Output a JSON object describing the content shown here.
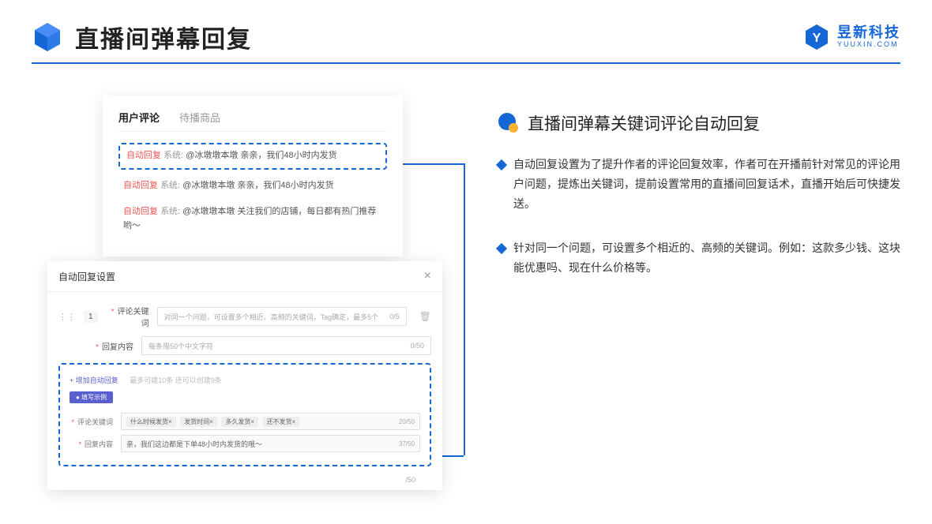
{
  "header": {
    "title": "直播间弹幕回复",
    "brand_cn": "昱新科技",
    "brand_en": "YUUXIN.COM"
  },
  "comment_panel": {
    "tabs": [
      "用户评论",
      "待播商品"
    ],
    "active_tab": 0,
    "items": [
      {
        "tag": "自动回复",
        "system": "系统:",
        "text": "@冰墩墩本墩 亲亲，我们48小时内发货",
        "highlight": true
      },
      {
        "tag": "自动回复",
        "system": "系统:",
        "text": "@冰墩墩本墩 亲亲，我们48小时内发货",
        "highlight": false
      },
      {
        "tag": "自动回复",
        "system": "系统:",
        "text": "@冰墩墩本墩 关注我们的店铺，每日都有热门推荐哟～",
        "highlight": false
      }
    ]
  },
  "settings_panel": {
    "title": "自动回复设置",
    "index": "1",
    "form": {
      "keyword_label": "评论关键词",
      "keyword_placeholder": "对同一个问题，可设置多个相近、高频的关键词，Tag确定，最多5个",
      "keyword_counter": "0/5",
      "content_label": "回复内容",
      "content_placeholder": "每条限50个中文字符",
      "content_counter": "0/50"
    },
    "add_link": "+ 增加自动回复",
    "add_hint": "最多可建10条 还可以创建9条",
    "example_tag": "● 填写示例",
    "example": {
      "keyword_label": "评论关键词",
      "keyword_tags": [
        "什么时候发货×",
        "发货时间×",
        "多久发货×",
        "还不发货×"
      ],
      "keyword_counter": "20/50",
      "content_label": "回复内容",
      "content_text": "亲，我们这边都是下单48小时内发货的哦～",
      "content_counter": "37/50"
    },
    "trailing_counter": "/50"
  },
  "right": {
    "section_title": "直播间弹幕关键词评论自动回复",
    "bullets": [
      "自动回复设置为了提升作者的评论回复效率，作者可在开播前针对常见的评论用户问题，提炼出关键词，提前设置常用的直播间回复话术，直播开始后可快捷发送。",
      "针对同一个问题，可设置多个相近的、高频的关键词。例如：这款多少钱、这块能优惠吗、现在什么价格等。"
    ]
  }
}
